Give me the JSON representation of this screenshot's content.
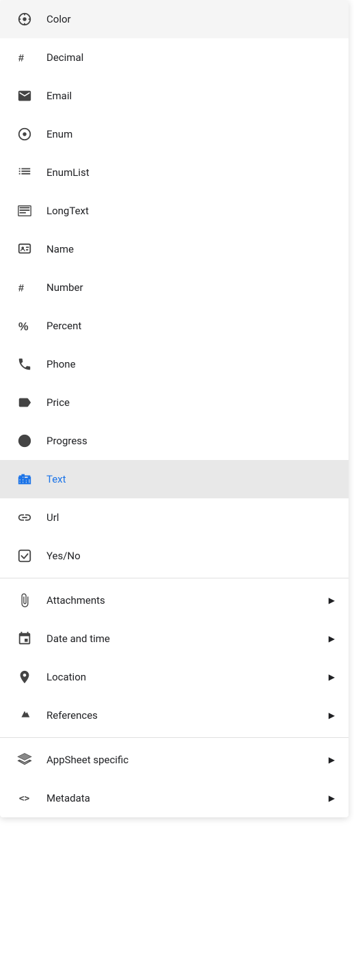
{
  "menu": {
    "items_top": [
      {
        "id": "color",
        "label": "Color",
        "icon": "color"
      },
      {
        "id": "decimal",
        "label": "Decimal",
        "icon": "decimal"
      },
      {
        "id": "email",
        "label": "Email",
        "icon": "email"
      },
      {
        "id": "enum",
        "label": "Enum",
        "icon": "enum"
      },
      {
        "id": "enumlist",
        "label": "EnumList",
        "icon": "enumlist"
      },
      {
        "id": "longtext",
        "label": "LongText",
        "icon": "longtext"
      },
      {
        "id": "name",
        "label": "Name",
        "icon": "name"
      },
      {
        "id": "number",
        "label": "Number",
        "icon": "number"
      },
      {
        "id": "percent",
        "label": "Percent",
        "icon": "percent"
      },
      {
        "id": "phone",
        "label": "Phone",
        "icon": "phone"
      },
      {
        "id": "price",
        "label": "Price",
        "icon": "price"
      },
      {
        "id": "progress",
        "label": "Progress",
        "icon": "progress"
      },
      {
        "id": "text",
        "label": "Text",
        "icon": "text",
        "selected": true
      },
      {
        "id": "url",
        "label": "Url",
        "icon": "url"
      },
      {
        "id": "yesno",
        "label": "Yes/No",
        "icon": "yesno"
      }
    ],
    "items_submenu": [
      {
        "id": "attachments",
        "label": "Attachments",
        "icon": "attachments",
        "has_arrow": true
      },
      {
        "id": "date-time",
        "label": "Date and time",
        "icon": "datetime",
        "has_arrow": true
      },
      {
        "id": "location",
        "label": "Location",
        "icon": "location",
        "has_arrow": true
      },
      {
        "id": "references",
        "label": "References",
        "icon": "references",
        "has_arrow": true
      }
    ],
    "items_bottom": [
      {
        "id": "appsheet",
        "label": "AppSheet specific",
        "icon": "appsheet",
        "has_arrow": true
      },
      {
        "id": "metadata",
        "label": "Metadata",
        "icon": "metadata",
        "has_arrow": true
      }
    ]
  }
}
